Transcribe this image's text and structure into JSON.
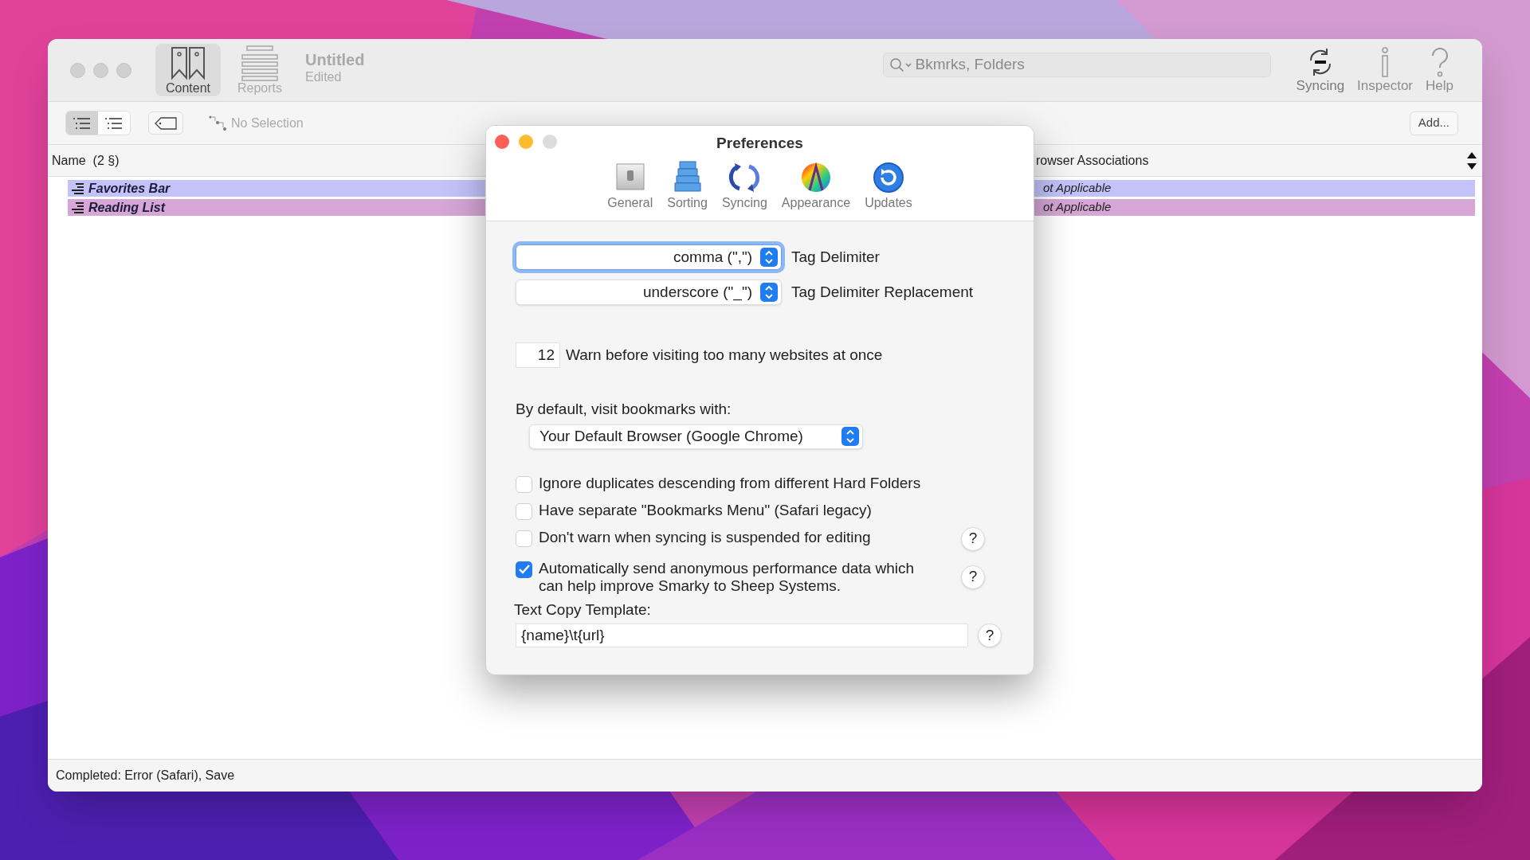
{
  "main_window": {
    "title": "Untitled",
    "subtitle": "Edited",
    "toolbar_left": [
      {
        "label": "Content",
        "selected": true
      },
      {
        "label": "Reports",
        "selected": false
      }
    ],
    "search": {
      "placeholder": "Bkmrks, Folders"
    },
    "toolbar_right": [
      {
        "label": "Syncing",
        "disabled": false
      },
      {
        "label": "Inspector",
        "disabled": true
      },
      {
        "label": "Help",
        "disabled": true
      }
    ],
    "view_mode": [
      {
        "selected": true
      },
      {
        "selected": false
      }
    ],
    "selection_label": "No Selection",
    "add_button": "Add...",
    "columns": [
      "Name  (2 §)",
      "rowser Associations"
    ],
    "rows": [
      {
        "name": "Favorites Bar",
        "association": "ot Applicable",
        "color": "#c3c3fa"
      },
      {
        "name": "Reading List",
        "association": "ot Applicable",
        "color": "#d6a6d6"
      }
    ],
    "status_bar": "Completed: Error (Safari), Save"
  },
  "preferences": {
    "title": "Preferences",
    "tabs": [
      {
        "label": "General",
        "selected": false
      },
      {
        "label": "Sorting",
        "selected": false
      },
      {
        "label": "Syncing",
        "selected": false
      },
      {
        "label": "Appearance",
        "selected": false
      },
      {
        "label": "Updates",
        "selected": false
      }
    ],
    "delimiters": [
      {
        "value": "comma (\",\")",
        "label": "Tag Delimiter",
        "focused": true
      },
      {
        "value": "underscore (\"_\")",
        "label": "Tag Delimiter Replacement",
        "focused": false
      }
    ],
    "warn_count": {
      "value": "12",
      "label": "Warn before visiting too many websites at once"
    },
    "browser_label": "By default, visit bookmarks with:",
    "browser_popup": "Your Default Browser (Google Chrome)",
    "checkboxes": [
      {
        "label": "Ignore duplicates descending from different Hard Folders",
        "checked": false
      },
      {
        "label": "Have separate \"Bookmarks Menu\" (Safari legacy)",
        "checked": false
      },
      {
        "label": "Don't warn when syncing is suspended for editing",
        "checked": false,
        "help": "?"
      },
      {
        "label": "Automatically send anonymous performance data which can help improve Smarky to Sheep Systems.",
        "checked": true,
        "help": "?"
      }
    ],
    "template_label": "Text Copy Template:",
    "template_value": "{name}\\t{url}",
    "template_help": "?"
  }
}
